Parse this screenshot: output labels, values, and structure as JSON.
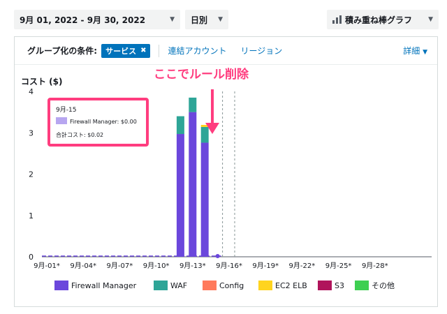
{
  "toolbar": {
    "date_range": "9月 01, 2022 - 9月 30, 2022",
    "granularity": "日別",
    "chart_type": "積み重ね棒グラフ"
  },
  "group_by": {
    "label": "グループ化の条件:",
    "token": "サービス",
    "options": [
      "連結アカウント",
      "リージョン"
    ],
    "detail": "詳細"
  },
  "annotation": {
    "text": "ここでルール削除",
    "color": "#ff3d7f"
  },
  "tooltip": {
    "date": "9月-15",
    "series": "Firewall Manager",
    "value": "Firewall Manager: $0.00",
    "total": "合計コスト: $0.02"
  },
  "colors": {
    "accent": "#0073bb",
    "highlight": "#ff3d7f"
  },
  "chart_data": {
    "type": "bar",
    "stacked": true,
    "ylabel": "コスト ($)",
    "ylim": [
      0,
      4
    ],
    "yticks": [
      "0",
      "1",
      "2",
      "3",
      "4"
    ],
    "x": [
      "9月-01*",
      "9月-02*",
      "9月-03*",
      "9月-04*",
      "9月-05*",
      "9月-06*",
      "9月-07*",
      "9月-08*",
      "9月-09*",
      "9月-10*",
      "9月-11*",
      "9月-12*",
      "9月-13*",
      "9月-14*",
      "9月-15*",
      "9月-16*",
      "9月-17*",
      "9月-18*",
      "9月-19*",
      "9月-20*",
      "9月-21*",
      "9月-22*",
      "9月-23*",
      "9月-24*",
      "9月-25*",
      "9月-26*",
      "9月-27*",
      "9月-28*",
      "9月-29*",
      "9月-30*"
    ],
    "xticks_every": 3,
    "series": [
      {
        "name": "Firewall Manager",
        "color": "#6b47dc",
        "values": [
          0.01,
          0.01,
          0.01,
          0.01,
          0.01,
          0.01,
          0.01,
          0.01,
          0.01,
          0.01,
          0.01,
          2.97,
          3.5,
          2.76,
          0.01,
          0,
          0,
          0,
          0,
          0,
          0,
          0,
          0,
          0,
          0,
          0,
          0,
          0,
          0,
          0
        ]
      },
      {
        "name": "WAF",
        "color": "#2ea597",
        "values": [
          0,
          0,
          0,
          0,
          0,
          0,
          0,
          0,
          0,
          0,
          0,
          0.43,
          0.35,
          0.38,
          0,
          0,
          0,
          0,
          0,
          0,
          0,
          0,
          0,
          0,
          0,
          0,
          0,
          0,
          0,
          0
        ]
      },
      {
        "name": "Config",
        "color": "#ff7a5c",
        "values": [
          0,
          0,
          0,
          0,
          0,
          0,
          0,
          0,
          0,
          0,
          0,
          0,
          0,
          0,
          0,
          0,
          0,
          0,
          0,
          0,
          0,
          0,
          0,
          0,
          0,
          0,
          0,
          0,
          0,
          0
        ]
      },
      {
        "name": "EC2 ELB",
        "color": "#ffd41f",
        "values": [
          0,
          0,
          0,
          0,
          0,
          0,
          0,
          0,
          0,
          0,
          0,
          0,
          0,
          0.05,
          0,
          0,
          0,
          0,
          0,
          0,
          0,
          0,
          0,
          0,
          0,
          0,
          0,
          0,
          0,
          0
        ]
      },
      {
        "name": "S3",
        "color": "#b0145b",
        "values": [
          0,
          0,
          0,
          0,
          0,
          0,
          0,
          0,
          0,
          0,
          0,
          0,
          0.01,
          0,
          0,
          0,
          0,
          0,
          0,
          0,
          0,
          0,
          0,
          0,
          0,
          0,
          0,
          0,
          0,
          0
        ]
      },
      {
        "name": "その他",
        "color": "#3ecf52",
        "values": [
          0,
          0,
          0,
          0,
          0,
          0,
          0,
          0,
          0,
          0,
          0,
          0,
          0,
          0,
          0,
          0,
          0,
          0,
          0,
          0,
          0,
          0,
          0,
          0,
          0,
          0,
          0,
          0,
          0,
          0
        ]
      }
    ],
    "dashed_markers": [
      "9月-15*",
      "9月-16*"
    ],
    "legend_position": "bottom",
    "grid": false
  }
}
